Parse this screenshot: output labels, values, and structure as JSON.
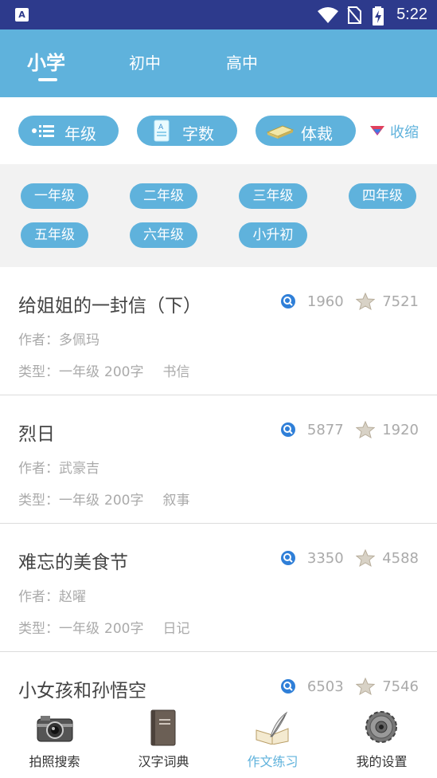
{
  "status_bar": {
    "time": "5:22",
    "app_icon": "A"
  },
  "top_tabs": [
    {
      "label": "小学",
      "active": true
    },
    {
      "label": "初中",
      "active": false
    },
    {
      "label": "高中",
      "active": false
    }
  ],
  "filters": {
    "grade_label": "年级",
    "wordcount_label": "字数",
    "genre_label": "体裁",
    "collapse_label": "收缩"
  },
  "grades": [
    "一年级",
    "二年级",
    "三年级",
    "四年级",
    "五年级",
    "六年级",
    "小升初"
  ],
  "articles": [
    {
      "title": "给姐姐的一封信（下）",
      "author": "作者：多佩玛",
      "type_prefix": "类型：",
      "grade": "一年级",
      "words": "200字",
      "genre": "书信",
      "views": "1960",
      "stars": "7521"
    },
    {
      "title": "烈日",
      "author": "作者：武豪吉",
      "type_prefix": "类型：",
      "grade": "一年级",
      "words": "200字",
      "genre": "叙事",
      "views": "5877",
      "stars": "1920"
    },
    {
      "title": "难忘的美食节",
      "author": "作者：赵曜",
      "type_prefix": "类型：",
      "grade": "一年级",
      "words": "200字",
      "genre": "日记",
      "views": "3350",
      "stars": "4588"
    },
    {
      "title": "小女孩和孙悟空",
      "author": "",
      "type_prefix": "",
      "grade": "",
      "words": "",
      "genre": "",
      "views": "6503",
      "stars": "7546"
    }
  ],
  "bottom_nav": [
    {
      "label": "拍照搜索",
      "icon": "camera-icon",
      "active": false
    },
    {
      "label": "汉字词典",
      "icon": "book-icon",
      "active": false
    },
    {
      "label": "作文练习",
      "icon": "quill-notebook-icon",
      "active": true
    },
    {
      "label": "我的设置",
      "icon": "gear-icon",
      "active": false
    }
  ],
  "colors": {
    "accent": "#5fb2dc",
    "status_bar": "#2d3a8c",
    "text_dark": "#444444",
    "text_muted": "#aaaaaa"
  }
}
